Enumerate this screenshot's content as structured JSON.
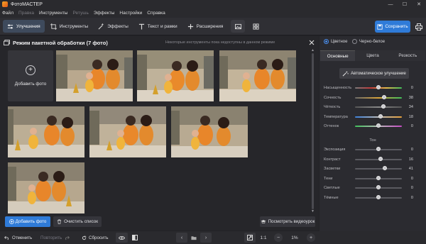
{
  "window": {
    "title": "ФотоМАСТЕР",
    "controls": [
      "—",
      "☐",
      "✕"
    ]
  },
  "menu": [
    {
      "label": "Файл",
      "dim": false
    },
    {
      "label": "Правка",
      "dim": true
    },
    {
      "label": "Инструменты",
      "dim": false
    },
    {
      "label": "Ретушь",
      "dim": true
    },
    {
      "label": "Эффекты",
      "dim": false
    },
    {
      "label": "Настройки",
      "dim": false
    },
    {
      "label": "Справка",
      "dim": false
    }
  ],
  "toolbar": {
    "tabs": [
      {
        "label": "Улучшения",
        "icon": "sliders-icon",
        "active": true
      },
      {
        "label": "Инструменты",
        "icon": "crop-icon",
        "active": false
      },
      {
        "label": "Эффекты",
        "icon": "magic-wand-icon",
        "active": false
      },
      {
        "label": "Текст и рамки",
        "icon": "text-icon",
        "active": false
      },
      {
        "label": "Расширения",
        "icon": "plus-icon",
        "active": false
      }
    ],
    "save_label": "Сохранить"
  },
  "batch": {
    "title": "Режим пакетной обработки (7 фото)",
    "notice": "Некоторые инструменты пока недоступны в данном режиме",
    "add_tile_label": "Добавить фото",
    "photo_count": 7
  },
  "actions": {
    "add_photo": "Добавить фото",
    "clear_list": "Очистить список",
    "video_lessons": "Посмотреть видеоурок"
  },
  "bottom": {
    "undo": "Отменить",
    "redo": "Повторить",
    "reset": "Сбросить",
    "ratio": "1:1",
    "zoom": "1%"
  },
  "side": {
    "color_mode": "Цветное",
    "bw_mode": "Черно-белое",
    "tabs": [
      "Основные",
      "Цвета",
      "Резкость"
    ],
    "auto_button": "Автоматическое улучшение",
    "sliders_top": [
      {
        "label": "Насыщенность",
        "value": "0",
        "pos": 0.5
      },
      {
        "label": "Сочность",
        "value": "38",
        "pos": 0.62
      },
      {
        "label": "Чёткость",
        "value": "34",
        "pos": 0.6
      },
      {
        "label": "Температура",
        "value": "18",
        "pos": 0.55
      },
      {
        "label": "Оттенок",
        "value": "0",
        "pos": 0.5
      }
    ],
    "section_tone": "Тон",
    "sliders_tone": [
      {
        "label": "Экспозиция",
        "value": "0",
        "pos": 0.5
      },
      {
        "label": "Контраст",
        "value": "16",
        "pos": 0.55
      },
      {
        "label": "Засветки",
        "value": "41",
        "pos": 0.64
      },
      {
        "label": "Тени",
        "value": "0",
        "pos": 0.5
      },
      {
        "label": "Светлые",
        "value": "0",
        "pos": 0.5
      },
      {
        "label": "Тёмные",
        "value": "0",
        "pos": 0.5
      }
    ]
  },
  "colors": {
    "accent": "#2f7bd8",
    "background": "#26262a",
    "panel": "#2b2b30"
  }
}
